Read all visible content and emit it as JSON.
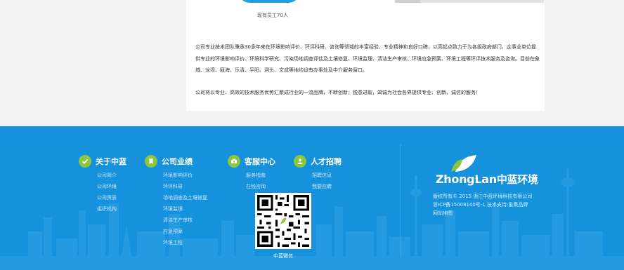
{
  "intro": {
    "staff_caption": "现有员工70人",
    "paragraph1": "公司专业技术团队秉承30多年来在环境影响评价、环评科研、咨询等领域的丰富经验、专业精神和良好口碑，以高起点致力于为各级政府部门、企事业单位提供专业的环境影响评价、环境科学研究、污染场地调查评估及土壤修复、环境监理、清洁生产审核、环境应急预案、环境工程等环评技术服务及咨询。目前在象城、龙湾、瓯海、乐清、平阳、洞头、文成等地均设有办事处及中介服务窗口。",
    "paragraph2": "公司将以专业、高效的技术服务优势汇聚成行业的一流品牌，不断创新，锐意进取，竭诚为社会各界提供专业、创新、诚信的服务！"
  },
  "footer": {
    "columns": [
      {
        "title": "关于中蓝",
        "icon": "check-icon",
        "links": [
          "公司简介",
          "公司环境",
          "公司资质",
          "组织机构"
        ]
      },
      {
        "title": "公司业绩",
        "icon": "bookmark-icon",
        "links": [
          "环境影响评价",
          "环评科研",
          "场地调查及土壤修复",
          "环境监理",
          "清洁生产审核",
          "应急预案",
          "环境工程"
        ]
      },
      {
        "title": "客服中心",
        "icon": "phone-icon",
        "links": [
          "服务指南",
          "在线咨询"
        ]
      },
      {
        "title": "人才招聘",
        "icon": "person-icon",
        "links": [
          "招聘信息",
          "我要应聘"
        ]
      }
    ],
    "qr_caption": "中蓝微信",
    "logo_latin": "ZhongLan",
    "logo_cn": "中蓝环境",
    "copyright_lines": [
      "版权所有© 2015 浙江中蓝环境科技有限公司",
      "浙ICP备15008140号-1   技术支持:象集品牌",
      "网站地图"
    ],
    "colors": {
      "footer_bg": "#1592db",
      "accent_green": "#8cc63f",
      "accent_blue": "#1e9fe0"
    }
  }
}
